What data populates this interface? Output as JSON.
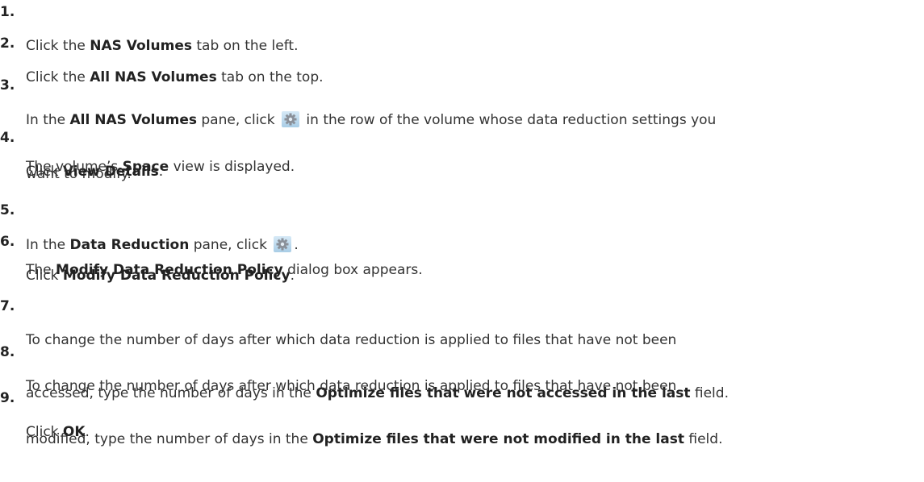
{
  "steps": [
    {
      "num": "1.",
      "pre": "Click the ",
      "bold": "NAS Volumes",
      "post": " tab on the left."
    },
    {
      "num": "2.",
      "pre": "Click the ",
      "bold": "All NAS Volumes",
      "post": " tab on the top."
    },
    {
      "num": "3.",
      "pre": "In the ",
      "bold": "All NAS Volumes",
      "mid": " pane, click ",
      "post": " in the row of the volume whose data reduction settings you",
      "cont": "want to modify."
    },
    {
      "num": "4.",
      "pre": "Click ",
      "bold": "View Details",
      "post": ".",
      "info_pre": "The volume’s ",
      "info_bold": "Space",
      "info_post": " view is displayed."
    },
    {
      "num": "5.",
      "pre": "In the ",
      "bold": "Data Reduction",
      "mid": " pane, click ",
      "post": "."
    },
    {
      "num": "6.",
      "pre": "Click ",
      "bold": "Modify Data Reduction Policy",
      "post": ".",
      "info_pre": "The ",
      "info_bold": "Modify Data Reduction Policy",
      "info_post": " dialog box appears."
    },
    {
      "num": "7.",
      "line1": "To change the number of days after which data reduction is applied to files that have not been",
      "pre": "accessed, type the number of days in the ",
      "bold": "Optimize files that were not accessed in the last",
      "post": " field."
    },
    {
      "num": "8.",
      "line1": "To change the number of days after which data reduction is applied to files that have not been",
      "pre": "modified, type the number of days in the ",
      "bold": "Optimize files that were not modified in the last",
      "post": " field."
    },
    {
      "num": "9.",
      "pre": "Click ",
      "bold": "OK",
      "post": "."
    }
  ],
  "icons": {
    "gear": "gear-icon"
  }
}
